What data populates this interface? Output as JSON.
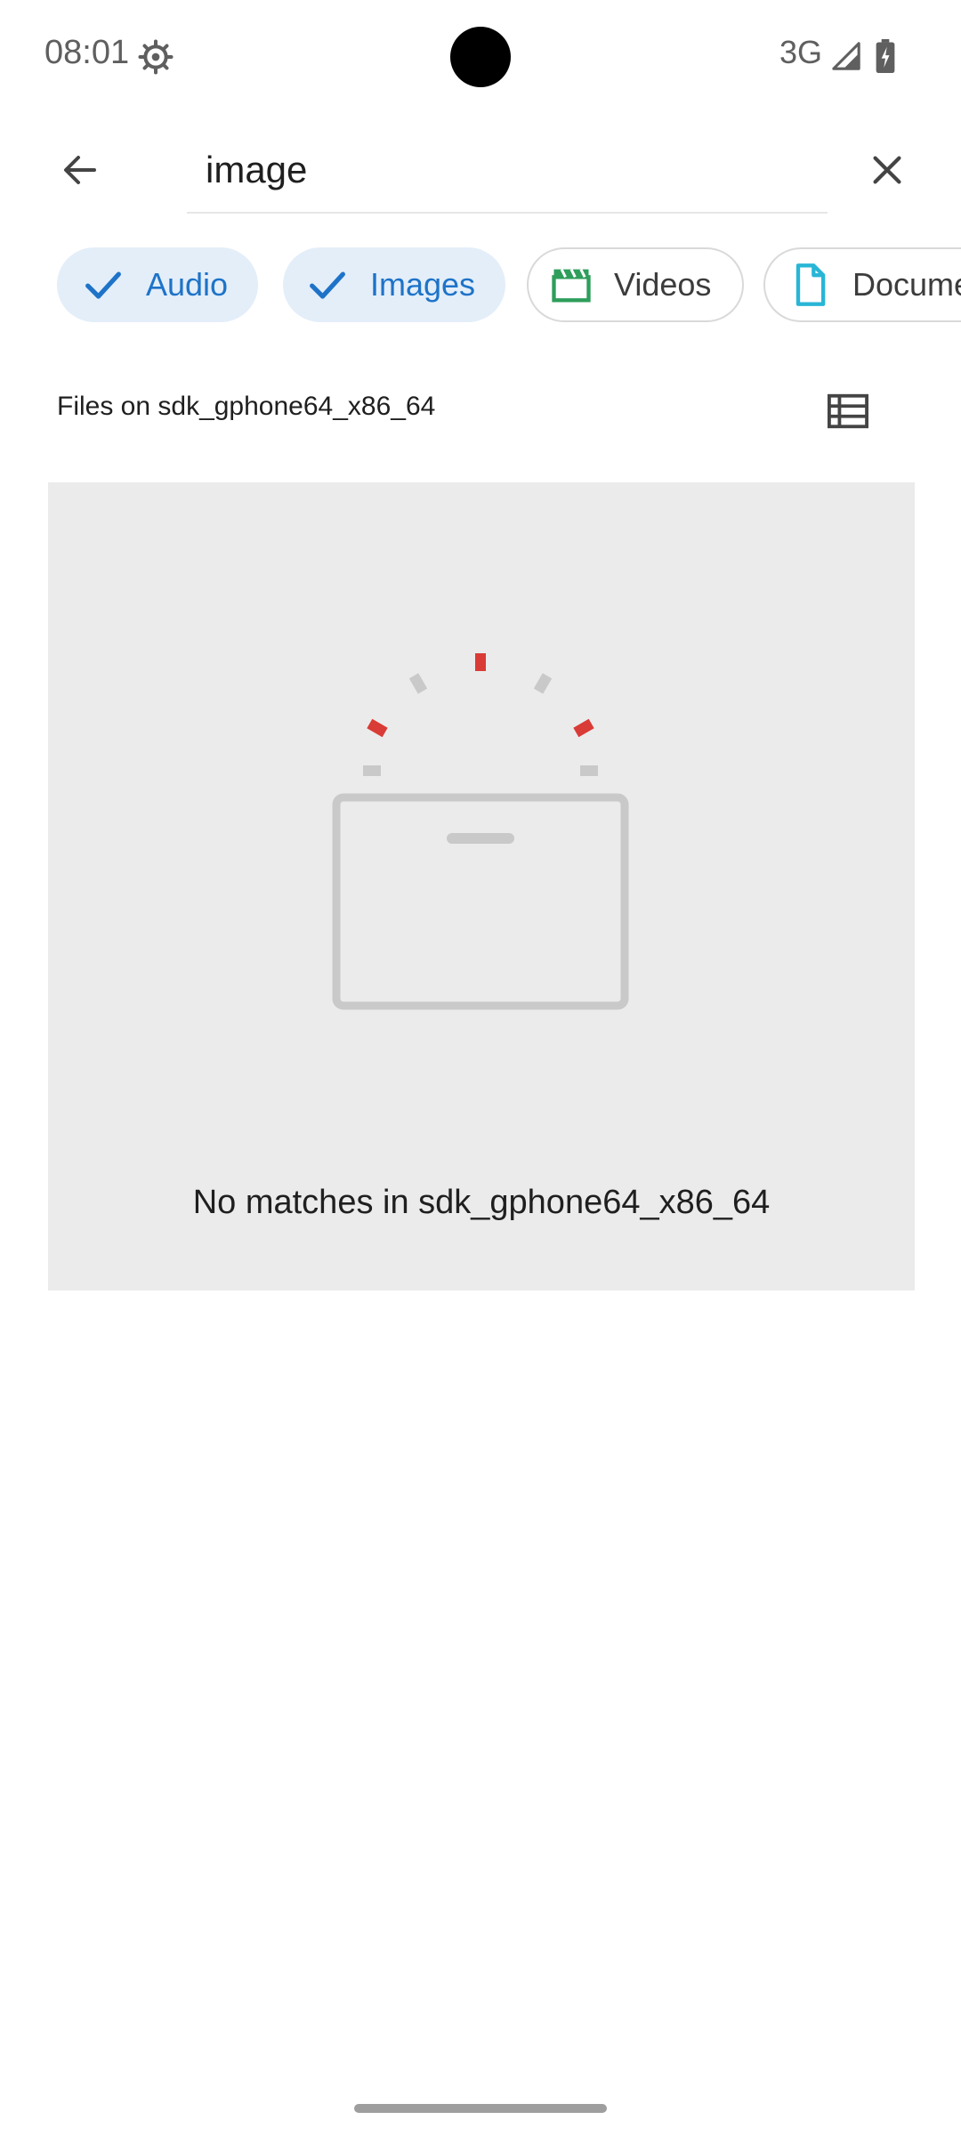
{
  "status_bar": {
    "time": "08:01",
    "network": "3G",
    "icons": [
      "settings-gear-icon",
      "signal-icon",
      "battery-charging-icon"
    ]
  },
  "search": {
    "value": "image",
    "icons": [
      "back-arrow-icon",
      "close-icon"
    ]
  },
  "chips": [
    {
      "label": "Audio",
      "selected": true,
      "icon": "check-icon"
    },
    {
      "label": "Images",
      "selected": true,
      "icon": "check-icon"
    },
    {
      "label": "Videos",
      "selected": false,
      "icon": "clapperboard-icon"
    },
    {
      "label": "Documents",
      "selected": false,
      "icon": "document-icon"
    }
  ],
  "files_header": {
    "label": "Files on sdk_gphone64_x86_64",
    "view_toggle_icon": "list-view-icon"
  },
  "empty_state": {
    "message": "No matches in sdk_gphone64_x86_64",
    "illustration": "empty-folder-icon"
  },
  "colors": {
    "accent": "#1e73c8",
    "chip_selected_bg": "#e3eef9",
    "video_icon": "#2e9e5b",
    "document_icon": "#29b6d6",
    "empty_bg": "#ebebeb",
    "illustration_red": "#d93b36"
  }
}
